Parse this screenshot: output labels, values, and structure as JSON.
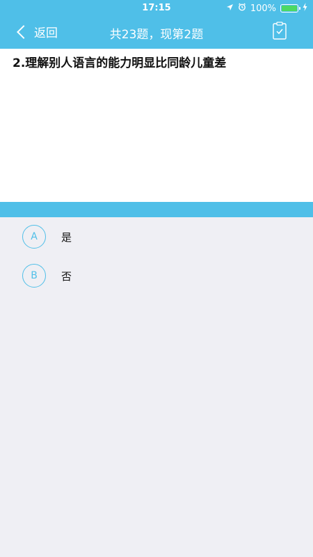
{
  "status_bar": {
    "time": "17:15",
    "battery_percent": "100%",
    "battery_level": 1.0,
    "battery_color": "#4cd964",
    "icons": [
      "location-icon",
      "alarm-icon",
      "charging-icon"
    ]
  },
  "nav": {
    "back_label": "返回",
    "title": "共23题，现第2题",
    "right_icon": "clipboard-check-icon"
  },
  "question": {
    "text": "2.理解别人语言的能力明显比同龄儿童差"
  },
  "options": [
    {
      "letter": "A",
      "text": "是"
    },
    {
      "letter": "B",
      "text": "否"
    }
  ],
  "colors": {
    "accent": "#4fbfe8",
    "background": "#efeff4",
    "panel": "#ffffff"
  }
}
